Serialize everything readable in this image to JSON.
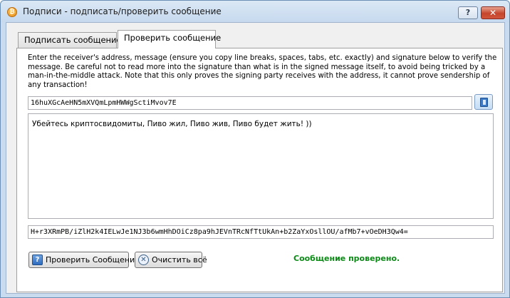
{
  "window": {
    "title": "Подписи - подписать/проверить сообщение",
    "help_label": "?",
    "close_label": "✕"
  },
  "tabs": [
    {
      "label": "Подписать сообщение",
      "active": false
    },
    {
      "label": "Проверить сообщение",
      "active": true
    }
  ],
  "verify": {
    "info": "Enter the receiver's address, message (ensure you copy line breaks, spaces, tabs, etc. exactly) and signature below to verify the message. Be careful not to read more into the signature than what is in the signed message itself, to avoid being tricked by a man-in-the-middle attack. Note that this only proves the signing party receives with the address, it cannot prove sendership of any transaction!",
    "address": "16huXGcAeHN5mXVQmLpmHWWgSctiMvov7E",
    "message": "Убейтесь криптосвидомиты, Пиво жил, Пиво жив, Пиво будет жить! ))",
    "signature": "H+r3XRmPB/iZlH2k4IELwJe1NJ3b6wmHhDOiCz8pa9hJEVnTRcNfTtUkAn+b2ZaYxOsllOU/afMb7+vOeDH3Qw4=",
    "verify_button": "Проверить Сообщение",
    "clear_button": "Очистить всё",
    "status": "Сообщение проверено.",
    "status_color": "#0b8a16"
  },
  "icons": {
    "app": "bitcoin-icon",
    "address_book": "address-book-icon",
    "verify": "question-icon",
    "clear": "clear-icon"
  }
}
